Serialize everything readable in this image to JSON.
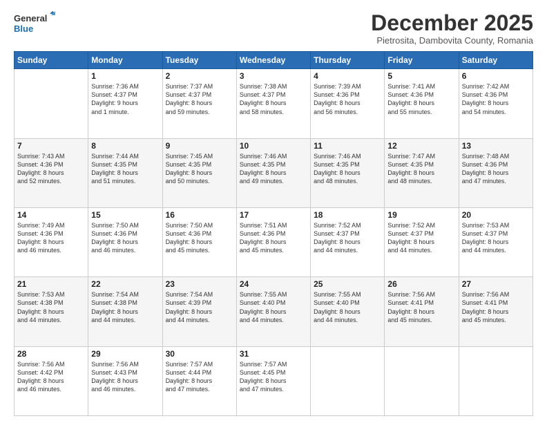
{
  "logo": {
    "line1": "General",
    "line2": "Blue"
  },
  "header": {
    "month_year": "December 2025",
    "location": "Pietrosita, Dambovita County, Romania"
  },
  "weekdays": [
    "Sunday",
    "Monday",
    "Tuesday",
    "Wednesday",
    "Thursday",
    "Friday",
    "Saturday"
  ],
  "weeks": [
    [
      {
        "day": "",
        "info": ""
      },
      {
        "day": "1",
        "info": "Sunrise: 7:36 AM\nSunset: 4:37 PM\nDaylight: 9 hours\nand 1 minute."
      },
      {
        "day": "2",
        "info": "Sunrise: 7:37 AM\nSunset: 4:37 PM\nDaylight: 8 hours\nand 59 minutes."
      },
      {
        "day": "3",
        "info": "Sunrise: 7:38 AM\nSunset: 4:37 PM\nDaylight: 8 hours\nand 58 minutes."
      },
      {
        "day": "4",
        "info": "Sunrise: 7:39 AM\nSunset: 4:36 PM\nDaylight: 8 hours\nand 56 minutes."
      },
      {
        "day": "5",
        "info": "Sunrise: 7:41 AM\nSunset: 4:36 PM\nDaylight: 8 hours\nand 55 minutes."
      },
      {
        "day": "6",
        "info": "Sunrise: 7:42 AM\nSunset: 4:36 PM\nDaylight: 8 hours\nand 54 minutes."
      }
    ],
    [
      {
        "day": "7",
        "info": "Sunrise: 7:43 AM\nSunset: 4:36 PM\nDaylight: 8 hours\nand 52 minutes."
      },
      {
        "day": "8",
        "info": "Sunrise: 7:44 AM\nSunset: 4:35 PM\nDaylight: 8 hours\nand 51 minutes."
      },
      {
        "day": "9",
        "info": "Sunrise: 7:45 AM\nSunset: 4:35 PM\nDaylight: 8 hours\nand 50 minutes."
      },
      {
        "day": "10",
        "info": "Sunrise: 7:46 AM\nSunset: 4:35 PM\nDaylight: 8 hours\nand 49 minutes."
      },
      {
        "day": "11",
        "info": "Sunrise: 7:46 AM\nSunset: 4:35 PM\nDaylight: 8 hours\nand 48 minutes."
      },
      {
        "day": "12",
        "info": "Sunrise: 7:47 AM\nSunset: 4:35 PM\nDaylight: 8 hours\nand 48 minutes."
      },
      {
        "day": "13",
        "info": "Sunrise: 7:48 AM\nSunset: 4:36 PM\nDaylight: 8 hours\nand 47 minutes."
      }
    ],
    [
      {
        "day": "14",
        "info": "Sunrise: 7:49 AM\nSunset: 4:36 PM\nDaylight: 8 hours\nand 46 minutes."
      },
      {
        "day": "15",
        "info": "Sunrise: 7:50 AM\nSunset: 4:36 PM\nDaylight: 8 hours\nand 46 minutes."
      },
      {
        "day": "16",
        "info": "Sunrise: 7:50 AM\nSunset: 4:36 PM\nDaylight: 8 hours\nand 45 minutes."
      },
      {
        "day": "17",
        "info": "Sunrise: 7:51 AM\nSunset: 4:36 PM\nDaylight: 8 hours\nand 45 minutes."
      },
      {
        "day": "18",
        "info": "Sunrise: 7:52 AM\nSunset: 4:37 PM\nDaylight: 8 hours\nand 44 minutes."
      },
      {
        "day": "19",
        "info": "Sunrise: 7:52 AM\nSunset: 4:37 PM\nDaylight: 8 hours\nand 44 minutes."
      },
      {
        "day": "20",
        "info": "Sunrise: 7:53 AM\nSunset: 4:37 PM\nDaylight: 8 hours\nand 44 minutes."
      }
    ],
    [
      {
        "day": "21",
        "info": "Sunrise: 7:53 AM\nSunset: 4:38 PM\nDaylight: 8 hours\nand 44 minutes."
      },
      {
        "day": "22",
        "info": "Sunrise: 7:54 AM\nSunset: 4:38 PM\nDaylight: 8 hours\nand 44 minutes."
      },
      {
        "day": "23",
        "info": "Sunrise: 7:54 AM\nSunset: 4:39 PM\nDaylight: 8 hours\nand 44 minutes."
      },
      {
        "day": "24",
        "info": "Sunrise: 7:55 AM\nSunset: 4:40 PM\nDaylight: 8 hours\nand 44 minutes."
      },
      {
        "day": "25",
        "info": "Sunrise: 7:55 AM\nSunset: 4:40 PM\nDaylight: 8 hours\nand 44 minutes."
      },
      {
        "day": "26",
        "info": "Sunrise: 7:56 AM\nSunset: 4:41 PM\nDaylight: 8 hours\nand 45 minutes."
      },
      {
        "day": "27",
        "info": "Sunrise: 7:56 AM\nSunset: 4:41 PM\nDaylight: 8 hours\nand 45 minutes."
      }
    ],
    [
      {
        "day": "28",
        "info": "Sunrise: 7:56 AM\nSunset: 4:42 PM\nDaylight: 8 hours\nand 46 minutes."
      },
      {
        "day": "29",
        "info": "Sunrise: 7:56 AM\nSunset: 4:43 PM\nDaylight: 8 hours\nand 46 minutes."
      },
      {
        "day": "30",
        "info": "Sunrise: 7:57 AM\nSunset: 4:44 PM\nDaylight: 8 hours\nand 47 minutes."
      },
      {
        "day": "31",
        "info": "Sunrise: 7:57 AM\nSunset: 4:45 PM\nDaylight: 8 hours\nand 47 minutes."
      },
      {
        "day": "",
        "info": ""
      },
      {
        "day": "",
        "info": ""
      },
      {
        "day": "",
        "info": ""
      }
    ]
  ]
}
